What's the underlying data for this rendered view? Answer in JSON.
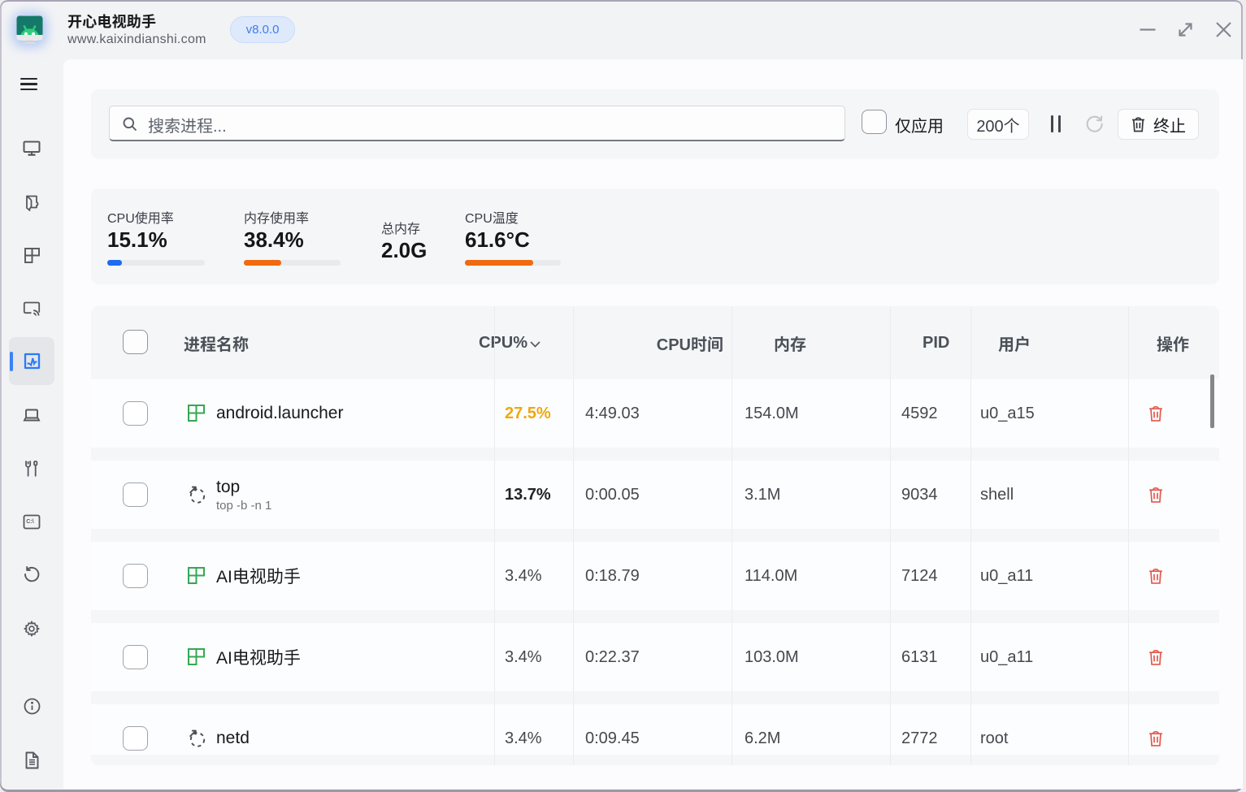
{
  "window": {
    "title": "开心电视助手",
    "subtitle": "www.kaixindianshi.com",
    "version_badge": "v8.0.0",
    "controls": {
      "minimize": "minimize",
      "resize": "resize",
      "close": "close"
    }
  },
  "sidebar": {
    "items": [
      {
        "id": "menu",
        "icon": "hamburger-icon",
        "active": false
      },
      {
        "id": "tv",
        "icon": "monitor-icon",
        "active": false
      },
      {
        "id": "apps",
        "icon": "apk-icon",
        "active": false
      },
      {
        "id": "layout",
        "icon": "grid-icon",
        "active": false
      },
      {
        "id": "cast",
        "icon": "screencast-icon",
        "active": false
      },
      {
        "id": "processes",
        "icon": "task-monitor-icon",
        "active": true
      },
      {
        "id": "device",
        "icon": "laptop-icon",
        "active": false
      },
      {
        "id": "tools",
        "icon": "tools-icon",
        "active": false
      },
      {
        "id": "terminal",
        "icon": "command-icon",
        "active": false
      },
      {
        "id": "restore",
        "icon": "restore-icon",
        "active": false
      },
      {
        "id": "settings",
        "icon": "gear-icon",
        "active": false
      },
      {
        "id": "about",
        "icon": "info-icon",
        "active": false
      },
      {
        "id": "logs",
        "icon": "document-icon",
        "active": false
      }
    ]
  },
  "toolbar": {
    "search_placeholder": "搜索进程...",
    "only_apps_label": "仅应用",
    "count_badge": "200个",
    "terminate_label": "终止"
  },
  "stats": {
    "cpu_usage": {
      "label": "CPU使用率",
      "value": "15.1%",
      "percent": 15.1,
      "bar_color": "#1c6cf2"
    },
    "memory_usage": {
      "label": "内存使用率",
      "value": "38.4%",
      "percent": 38.4,
      "bar_color": "#f06a10"
    },
    "total_memory": {
      "label": "总内存",
      "value": "2.0G"
    },
    "cpu_temp": {
      "label": "CPU温度",
      "value": "61.6°C",
      "percent": 72.0,
      "bar_color": "#f06a10"
    }
  },
  "table": {
    "headers": {
      "name": "进程名称",
      "cpu": "CPU%",
      "cpu_time": "CPU时间",
      "memory": "内存",
      "pid": "PID",
      "user": "用户",
      "actions": "操作"
    },
    "rows": [
      {
        "name": "android.launcher",
        "sub": "",
        "icon": "app-grid-icon",
        "cpu": "27.5%",
        "cpu_style": "amber",
        "time": "4:49.03",
        "mem": "154.0M",
        "pid": "4592",
        "user": "u0_a15"
      },
      {
        "name": "top",
        "sub": "top -b -n 1",
        "icon": "process-spinner-icon",
        "cpu": "13.7%",
        "cpu_style": "bold",
        "time": "0:00.05",
        "mem": "3.1M",
        "pid": "9034",
        "user": "shell"
      },
      {
        "name": "AI电视助手",
        "sub": "",
        "icon": "app-grid-icon",
        "cpu": "3.4%",
        "cpu_style": "normal",
        "time": "0:18.79",
        "mem": "114.0M",
        "pid": "7124",
        "user": "u0_a11"
      },
      {
        "name": "AI电视助手",
        "sub": "",
        "icon": "app-grid-icon",
        "cpu": "3.4%",
        "cpu_style": "normal",
        "time": "0:22.37",
        "mem": "103.0M",
        "pid": "6131",
        "user": "u0_a11"
      },
      {
        "name": "netd",
        "sub": "",
        "icon": "process-spinner-icon",
        "cpu": "3.4%",
        "cpu_style": "normal",
        "time": "0:09.45",
        "mem": "6.2M",
        "pid": "2772",
        "user": "root"
      }
    ]
  },
  "colors": {
    "accent_blue": "#3b82f6",
    "progress_blue": "#1c6cf2",
    "progress_orange": "#f06a10",
    "cpu_highlight_amber": "#f0a80d",
    "app_icon_green": "#34a853",
    "trash_red": "#e4574b",
    "mica_background": "#f2f3f5",
    "panel_background": "#fcfcfe",
    "card_background": "#f5f6f8"
  }
}
